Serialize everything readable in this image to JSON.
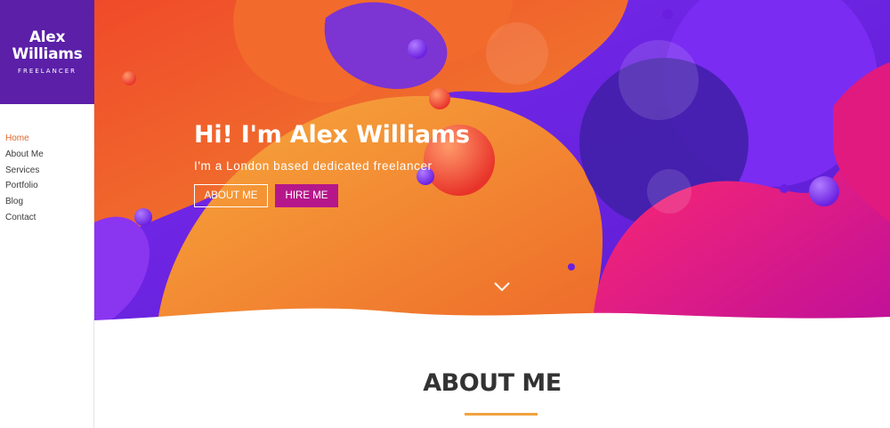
{
  "logo": {
    "name_line1": "Alex",
    "name_line2": "Williams",
    "tagline": "FREELANCER"
  },
  "nav": {
    "items": [
      {
        "label": "Home",
        "active": true
      },
      {
        "label": "About Me"
      },
      {
        "label": "Services"
      },
      {
        "label": "Portfolio"
      },
      {
        "label": "Blog"
      },
      {
        "label": "Contact"
      }
    ]
  },
  "hero": {
    "title": "Hi! I'm Alex Williams",
    "subtitle": "I'm a London based dedicated freelancer",
    "about_button": "ABOUT ME",
    "hire_button": "HIRE ME",
    "scroll_icon": "chevron-down-icon"
  },
  "about": {
    "title": "ABOUT ME"
  },
  "colors": {
    "sidebar_logo_bg": "#5b1fa8",
    "nav_active": "#e0652b",
    "hire_button_bg": "#b5178a",
    "underline_accent": "#f0a340",
    "hero_purple": "#6a1fe0",
    "hero_orange": "#f0822b",
    "hero_pink": "#e3147f",
    "hero_red": "#ea2d2d"
  }
}
